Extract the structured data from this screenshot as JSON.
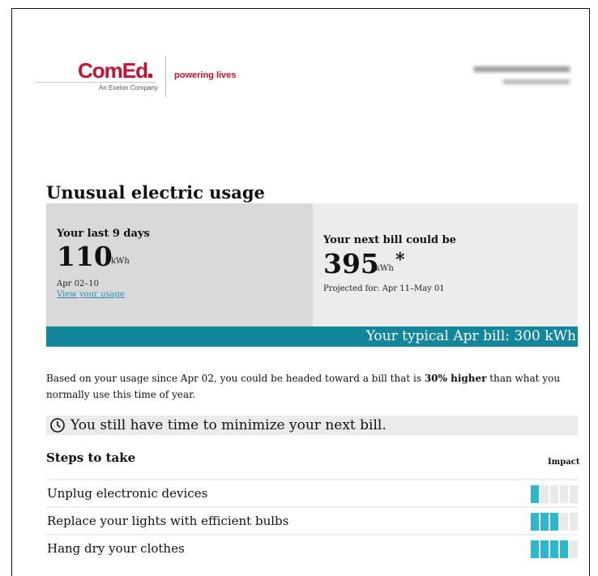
{
  "header": {
    "logo": "ComEd",
    "logo_sub": "An Exelon Company",
    "tagline": "powering lives"
  },
  "title": "Unusual electric usage",
  "last_days": {
    "label": "Your last 9 days",
    "value": "110",
    "unit": "kWh",
    "date_range": "Apr 02–10",
    "link": "View your usage"
  },
  "next_bill": {
    "label": "Your next bill could be",
    "value": "395",
    "unit": "kWh",
    "asterisk": "*",
    "projected": "Projected for: Apr 11–May 01"
  },
  "typical_bill": "Your typical Apr bill: 300 kWh",
  "summary": {
    "part1": "Based on your usage since Apr 02, you could be headed toward a bill that is ",
    "highlight": "30% higher",
    "part2": " than what you normally use this time of year."
  },
  "time_notice": "You still have time to minimize your next bill.",
  "steps": {
    "heading": "Steps to take",
    "impact_label": "Impact",
    "max_impact": 5,
    "items": [
      {
        "label": "Unplug electronic devices",
        "impact": 1
      },
      {
        "label": "Replace your lights with efficient bulbs",
        "impact": 3
      },
      {
        "label": "Hang dry your clothes",
        "impact": 4
      }
    ]
  },
  "colors": {
    "brand_red": "#c8102e",
    "teal_bar": "#13879a",
    "impact_on": "#2bb8cc",
    "impact_off": "#e9e9e9",
    "link": "#2a8bbf"
  },
  "icons": {
    "time": "clock-icon"
  }
}
